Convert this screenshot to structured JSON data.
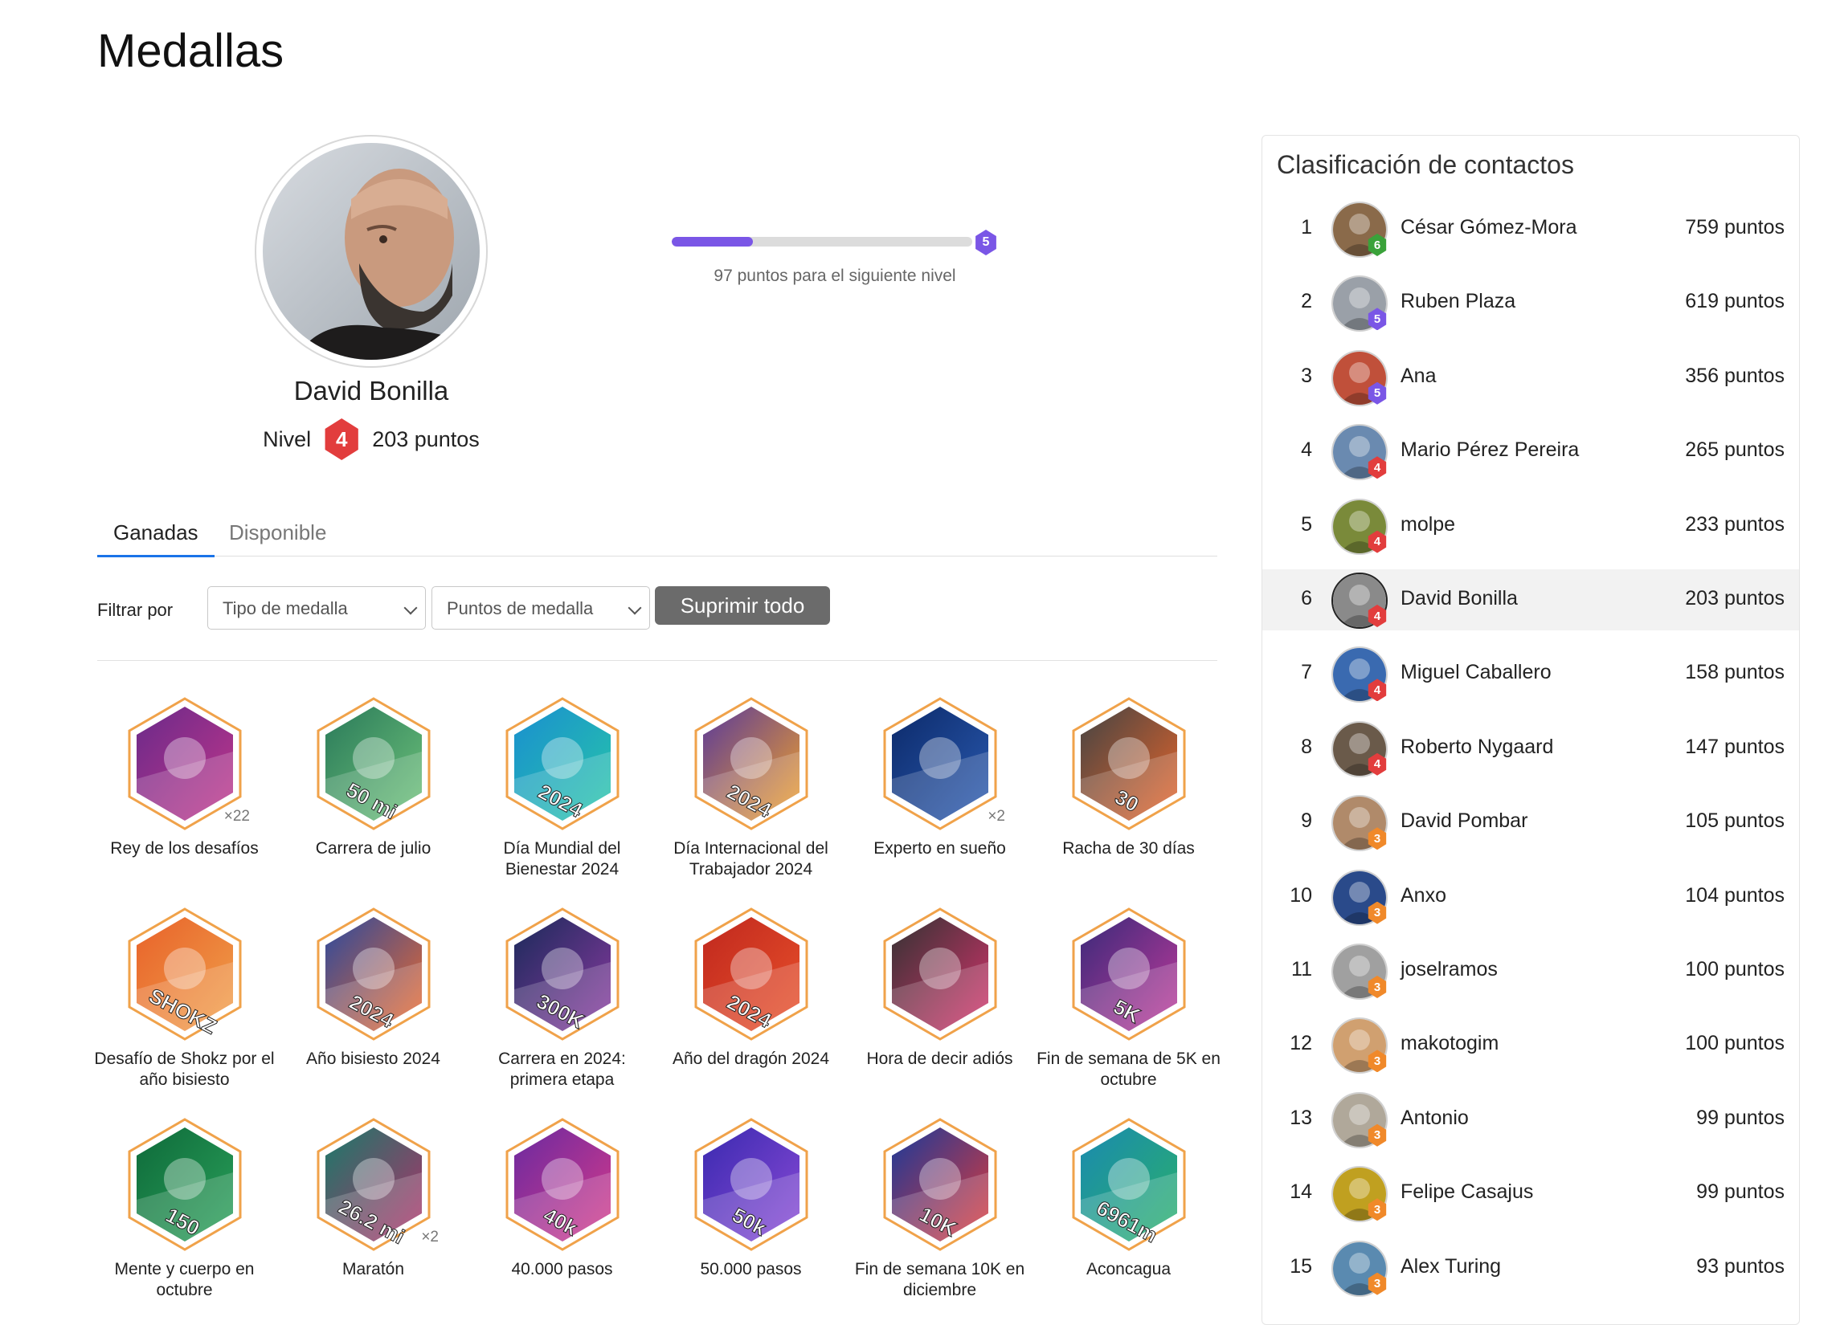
{
  "page": {
    "title": "Medallas"
  },
  "profile": {
    "name": "David Bonilla",
    "level_label": "Nivel",
    "level": "4",
    "points": "203 puntos",
    "next_level": "5",
    "progress_fraction": 0.27,
    "progress_text": "97 puntos para el siguiente nivel"
  },
  "tabs": [
    {
      "label": "Ganadas",
      "active": true
    },
    {
      "label": "Disponible",
      "active": false
    }
  ],
  "filters": {
    "label": "Filtrar por",
    "type_select": "Tipo de medalla",
    "points_select": "Puntos de medalla",
    "clear_button": "Suprimir todo"
  },
  "badges": [
    {
      "label": "Rey de los desafíos",
      "count": "×22",
      "colors": [
        "#6a2a8a",
        "#c1368a"
      ],
      "text": ""
    },
    {
      "label": "Carrera de julio",
      "count": "",
      "colors": [
        "#2a7a5a",
        "#6ec27a"
      ],
      "text": "50 mi"
    },
    {
      "label": "Día Mundial del Bienestar 2024",
      "count": "",
      "colors": [
        "#1a8fd0",
        "#27c6a8"
      ],
      "text": "2024"
    },
    {
      "label": "Día Internacional del Trabajador 2024",
      "count": "",
      "colors": [
        "#5a3a9a",
        "#f2a22a"
      ],
      "text": "2024"
    },
    {
      "label": "Experto en sueño",
      "count": "×2",
      "colors": [
        "#0c2a6a",
        "#2a5ab0"
      ],
      "text": ""
    },
    {
      "label": "Racha de 30 días",
      "count": "",
      "colors": [
        "#444444",
        "#e8652a"
      ],
      "text": "30"
    },
    {
      "label": "Desafío de Shokz por el año bisiesto",
      "count": "",
      "colors": [
        "#e8622a",
        "#f0a04a"
      ],
      "text": "SHOKZ"
    },
    {
      "label": "Año bisiesto 2024",
      "count": "",
      "colors": [
        "#2a4aa0",
        "#f06a2a"
      ],
      "text": "2024"
    },
    {
      "label": "Carrera en 2024: primera etapa",
      "count": "",
      "colors": [
        "#1a2a5a",
        "#8a3aa0"
      ],
      "text": "300K"
    },
    {
      "label": "Año del dragón 2024",
      "count": "",
      "colors": [
        "#c0281e",
        "#e8502a"
      ],
      "text": "2024"
    },
    {
      "label": "Hora de decir adiós",
      "count": "",
      "colors": [
        "#333333",
        "#d6336c"
      ],
      "text": ""
    },
    {
      "label": "Fin de semana de 5K en octubre",
      "count": "",
      "colors": [
        "#3a2a7a",
        "#c03a9a"
      ],
      "text": "5K"
    },
    {
      "label": "Mente y cuerpo en octubre",
      "count": "",
      "colors": [
        "#0e6a3a",
        "#2aa05a"
      ],
      "text": "150"
    },
    {
      "label": "Maratón",
      "count": "×2",
      "colors": [
        "#1a7a6a",
        "#b0306a"
      ],
      "text": "26.2 mi"
    },
    {
      "label": "40.000 pasos",
      "count": "",
      "colors": [
        "#6a2aa0",
        "#d63a8a"
      ],
      "text": "40k"
    },
    {
      "label": "50.000 pasos",
      "count": "",
      "colors": [
        "#3a2ab0",
        "#8a4ad6"
      ],
      "text": "50k"
    },
    {
      "label": "Fin de semana 10K en diciembre",
      "count": "",
      "colors": [
        "#1a3a9a",
        "#e03a3a"
      ],
      "text": "10K"
    },
    {
      "label": "Aconcagua",
      "count": "",
      "colors": [
        "#1a8ab0",
        "#2ab06a"
      ],
      "text": "6961m"
    }
  ],
  "leaderboard": {
    "title": "Clasificación de contactos",
    "rows": [
      {
        "rank": "1",
        "name": "César Gómez-Mora",
        "points": "759 puntos",
        "level": "6",
        "level_color": "#3aa23a",
        "avatar_color": "#8a6a4a"
      },
      {
        "rank": "2",
        "name": "Ruben Plaza",
        "points": "619 puntos",
        "level": "5",
        "level_color": "#7a56e6",
        "avatar_color": "#9aa0a8"
      },
      {
        "rank": "3",
        "name": "Ana",
        "points": "356 puntos",
        "level": "5",
        "level_color": "#7a56e6",
        "avatar_color": "#c0503a"
      },
      {
        "rank": "4",
        "name": "Mario Pérez Pereira",
        "points": "265 puntos",
        "level": "4",
        "level_color": "#e23d3d",
        "avatar_color": "#6a8ab0"
      },
      {
        "rank": "5",
        "name": "molpe",
        "points": "233 puntos",
        "level": "4",
        "level_color": "#e23d3d",
        "avatar_color": "#7a8a3a"
      },
      {
        "rank": "6",
        "name": "David Bonilla",
        "points": "203 puntos",
        "level": "4",
        "level_color": "#e23d3d",
        "avatar_color": "#8a8a8a",
        "me": true
      },
      {
        "rank": "7",
        "name": "Miguel Caballero",
        "points": "158 puntos",
        "level": "4",
        "level_color": "#e23d3d",
        "avatar_color": "#3a6ab0"
      },
      {
        "rank": "8",
        "name": "Roberto Nygaard",
        "points": "147 puntos",
        "level": "4",
        "level_color": "#e23d3d",
        "avatar_color": "#6a5a4a"
      },
      {
        "rank": "9",
        "name": "David Pombar",
        "points": "105 puntos",
        "level": "3",
        "level_color": "#f0892a",
        "avatar_color": "#b08a6a"
      },
      {
        "rank": "10",
        "name": "Anxo",
        "points": "104 puntos",
        "level": "3",
        "level_color": "#f0892a",
        "avatar_color": "#2a4a8a"
      },
      {
        "rank": "11",
        "name": "joselramos",
        "points": "100 puntos",
        "level": "3",
        "level_color": "#f0892a",
        "avatar_color": "#a0a0a0"
      },
      {
        "rank": "12",
        "name": "makotogim",
        "points": "100 puntos",
        "level": "3",
        "level_color": "#f0892a",
        "avatar_color": "#d0a070"
      },
      {
        "rank": "13",
        "name": "Antonio",
        "points": "99 puntos",
        "level": "3",
        "level_color": "#f0892a",
        "avatar_color": "#b0a89a"
      },
      {
        "rank": "14",
        "name": "Felipe Casajus",
        "points": "99 puntos",
        "level": "3",
        "level_color": "#f0892a",
        "avatar_color": "#c0a020"
      },
      {
        "rank": "15",
        "name": "Alex Turing",
        "points": "93 puntos",
        "level": "3",
        "level_color": "#f0892a",
        "avatar_color": "#5a8ab0"
      }
    ]
  }
}
